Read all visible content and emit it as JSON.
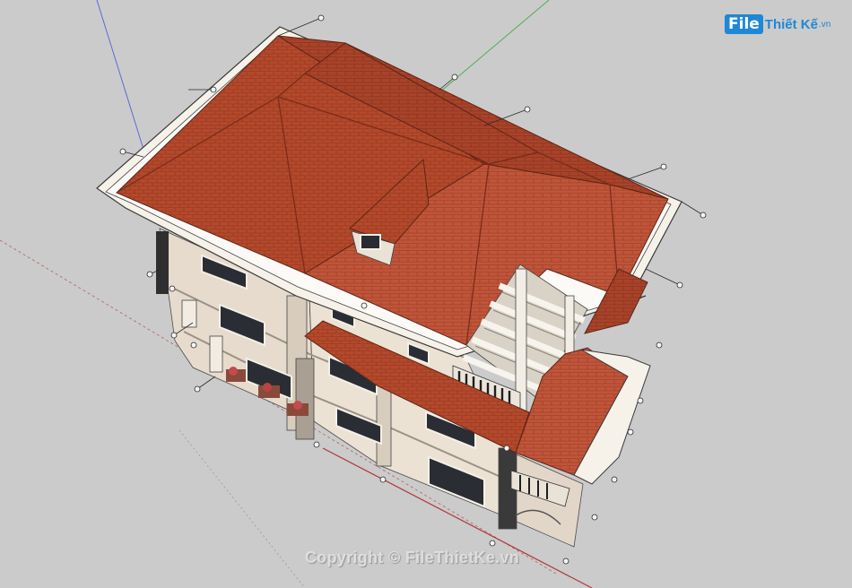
{
  "brand": {
    "badge": "File",
    "name": "Thiết Kế",
    "domain": ".vn",
    "color": "#1e88d6"
  },
  "watermark": {
    "text": "Copyright © FileThietKe.vn"
  },
  "colors": {
    "background": "#cbcbcb",
    "roof": "#b5482a",
    "roof_dark": "#8f3219",
    "wall": "#e8ddd0",
    "trim": "#f7f4ee",
    "axis_red": "#b0383a",
    "axis_green": "#4caf50",
    "axis_blue": "#5a6bd6"
  }
}
